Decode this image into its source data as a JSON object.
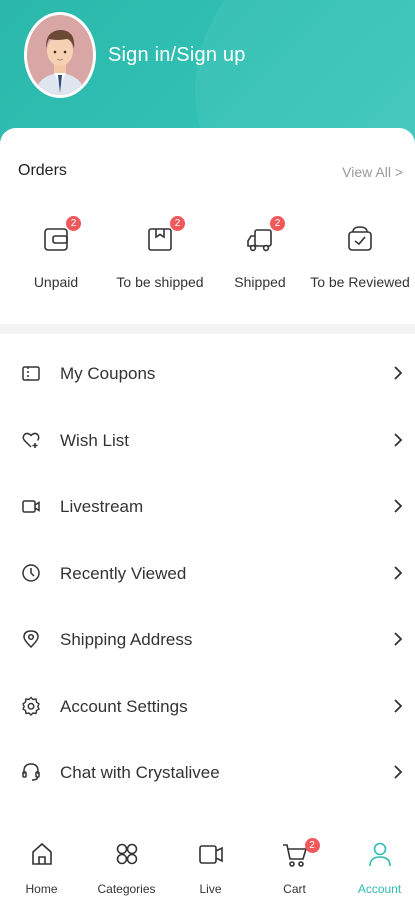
{
  "header": {
    "signin_label": "Sign in/Sign up",
    "color": "#30c0b3"
  },
  "orders": {
    "title": "Orders",
    "view_all": "View All >",
    "items": [
      {
        "label": "Unpaid",
        "badge": "2",
        "icon": "wallet-icon"
      },
      {
        "label": "To be shipped",
        "badge": "2",
        "icon": "package-icon"
      },
      {
        "label": "Shipped",
        "badge": "2",
        "icon": "truck-icon"
      },
      {
        "label": "To be Reviewed",
        "badge": "",
        "icon": "review-icon"
      }
    ]
  },
  "menu": {
    "items": [
      {
        "label": "My Coupons",
        "icon": "coupon-icon"
      },
      {
        "label": "Wish List",
        "icon": "heart-icon"
      },
      {
        "label": "Livestream",
        "icon": "video-icon"
      },
      {
        "label": "Recently Viewed",
        "icon": "clock-icon"
      },
      {
        "label": "Shipping Address",
        "icon": "location-icon"
      },
      {
        "label": "Account Settings",
        "icon": "gear-icon"
      },
      {
        "label": "Chat with Crystalivee",
        "icon": "headset-icon"
      }
    ]
  },
  "tabbar": {
    "items": [
      {
        "label": "Home",
        "icon": "home-icon"
      },
      {
        "label": "Categories",
        "icon": "categories-icon"
      },
      {
        "label": "Live",
        "icon": "live-icon"
      },
      {
        "label": "Cart",
        "icon": "cart-icon",
        "badge": "2"
      },
      {
        "label": "Account",
        "icon": "account-icon",
        "active": true
      }
    ],
    "active_color": "#31bdb0",
    "badge_color": "#f0595c"
  }
}
